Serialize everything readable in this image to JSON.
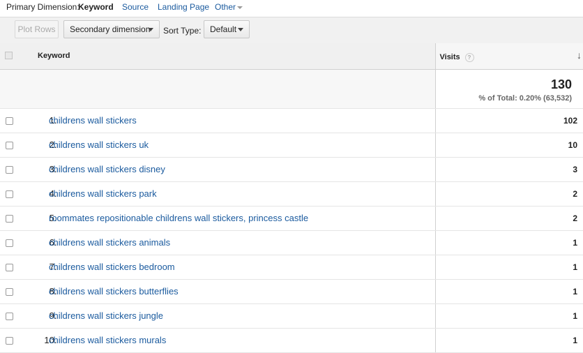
{
  "primary_dimension": {
    "label": "Primary Dimension:",
    "active": "Keyword",
    "links": [
      "Source",
      "Landing Page",
      "Other"
    ]
  },
  "toolbar": {
    "plot_rows": "Plot Rows",
    "secondary_dimension": "Secondary dimension",
    "sort_type_label": "Sort Type:",
    "sort_type_value": "Default"
  },
  "table": {
    "headers": {
      "keyword": "Keyword",
      "visits": "Visits",
      "help": "?"
    },
    "total": {
      "value": "130",
      "percent": "% of Total: 0.20% (63,532)"
    },
    "rows": [
      {
        "index": "1.",
        "keyword": "childrens wall stickers",
        "visits": "102"
      },
      {
        "index": "2.",
        "keyword": "childrens wall stickers uk",
        "visits": "10"
      },
      {
        "index": "3.",
        "keyword": "childrens wall stickers disney",
        "visits": "3"
      },
      {
        "index": "4.",
        "keyword": "childrens wall stickers park",
        "visits": "2"
      },
      {
        "index": "5.",
        "keyword": "roommates repositionable childrens wall stickers, princess castle",
        "visits": "2"
      },
      {
        "index": "6.",
        "keyword": "childrens wall stickers animals",
        "visits": "1"
      },
      {
        "index": "7.",
        "keyword": "childrens wall stickers bedroom",
        "visits": "1"
      },
      {
        "index": "8.",
        "keyword": "childrens wall stickers butterflies",
        "visits": "1"
      },
      {
        "index": "9.",
        "keyword": "childrens wall stickers jungle",
        "visits": "1"
      },
      {
        "index": "10.",
        "keyword": "childrens wall stickers murals",
        "visits": "1"
      }
    ]
  },
  "icons": {
    "sort": "sort-down-arrow-icon",
    "help": "help-icon",
    "dropdown": "chevron-down-icon"
  },
  "colors": {
    "link": "#1a5a9e",
    "toolbar_bg": "#f1f1f1",
    "header_bg": "#f0f0f0"
  }
}
